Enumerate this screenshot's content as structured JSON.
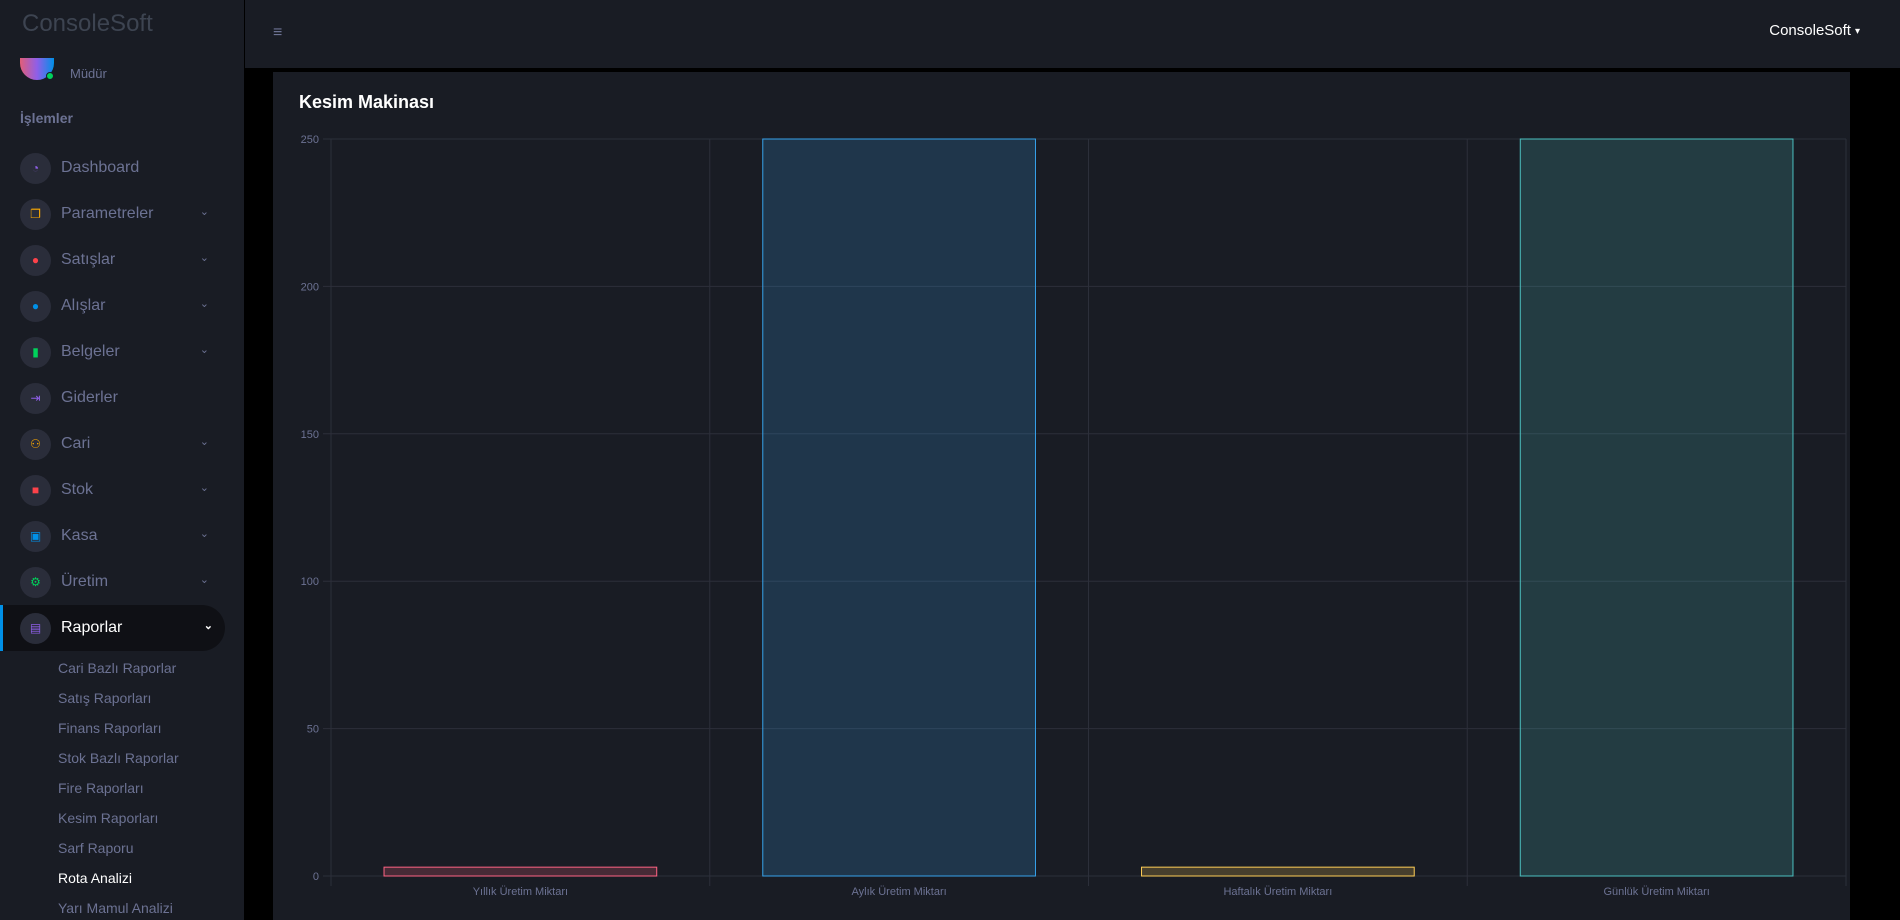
{
  "app": {
    "brand": "ConsoleSoft"
  },
  "topbar": {
    "user_label": "ConsoleSoft"
  },
  "profile": {
    "role": "Müdür"
  },
  "sidebar": {
    "section_title": "İşlemler",
    "items": [
      {
        "label": "Dashboard",
        "icon": "speedometer-icon",
        "color": "#8f5fe8",
        "glyph": "◔",
        "chevron": false
      },
      {
        "label": "Parametreler",
        "icon": "layers-icon",
        "color": "#ffab00",
        "glyph": "❐",
        "chevron": true
      },
      {
        "label": "Satışlar",
        "icon": "play-circle-icon",
        "color": "#fc424a",
        "glyph": "●",
        "chevron": true
      },
      {
        "label": "Alışlar",
        "icon": "telegram-icon",
        "color": "#0090e7",
        "glyph": "●",
        "chevron": true
      },
      {
        "label": "Belgeler",
        "icon": "book-icon",
        "color": "#00d25b",
        "glyph": "▮",
        "chevron": true
      },
      {
        "label": "Giderler",
        "icon": "arrow-right-bar-icon",
        "color": "#8f5fe8",
        "glyph": "⇥",
        "chevron": false
      },
      {
        "label": "Cari",
        "icon": "users-icon",
        "color": "#ffab00",
        "glyph": "⚇",
        "chevron": true
      },
      {
        "label": "Stok",
        "icon": "box-icon",
        "color": "#fc424a",
        "glyph": "■",
        "chevron": true
      },
      {
        "label": "Kasa",
        "icon": "cash-icon",
        "color": "#0090e7",
        "glyph": "▣",
        "chevron": true
      },
      {
        "label": "Üretim",
        "icon": "factory-icon",
        "color": "#00d25b",
        "glyph": "⚙",
        "chevron": true
      },
      {
        "label": "Raporlar",
        "icon": "clipboard-icon",
        "color": "#8f5fe8",
        "glyph": "▤",
        "chevron": true,
        "active": true
      }
    ],
    "sub_items": [
      {
        "label": "Cari Bazlı Raporlar"
      },
      {
        "label": "Satış Raporları"
      },
      {
        "label": "Finans Raporları"
      },
      {
        "label": "Stok Bazlı Raporlar"
      },
      {
        "label": "Fire Raporları"
      },
      {
        "label": "Kesim Raporları"
      },
      {
        "label": "Sarf Raporu"
      },
      {
        "label": "Rota Analizi",
        "current": true
      },
      {
        "label": "Yarı Mamul Analizi"
      }
    ]
  },
  "card": {
    "title": "Kesim Makinası"
  },
  "chart_data": {
    "type": "bar",
    "categories": [
      "Yıllık Üretim Miktarı",
      "Aylık Üretim Miktarı",
      "Haftalık Üretim Miktarı",
      "Günlük Üretim Miktarı"
    ],
    "values": [
      3,
      250,
      3,
      250
    ],
    "colors": [
      "#ff6384",
      "#36a2eb",
      "#ffce56",
      "#4bc0c0"
    ],
    "ylim": [
      0,
      250
    ],
    "yticks": [
      0,
      50,
      100,
      150,
      200,
      250
    ],
    "grid": true,
    "legend": "none"
  }
}
